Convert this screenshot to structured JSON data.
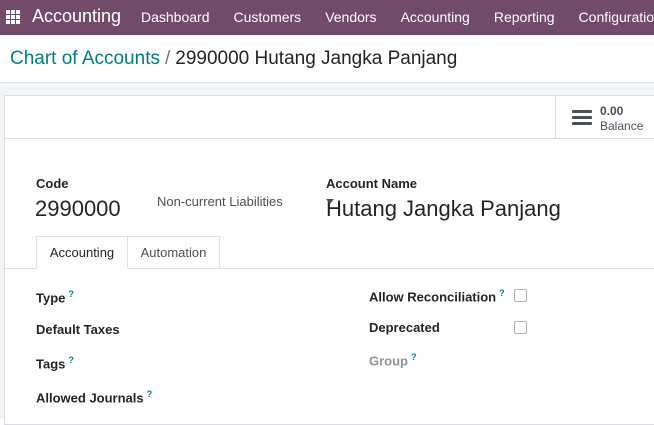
{
  "navbar": {
    "brand": "Accounting",
    "menu": [
      "Dashboard",
      "Customers",
      "Vendors",
      "Accounting",
      "Reporting",
      "Configuration"
    ]
  },
  "breadcrumb": {
    "parent": "Chart of Accounts",
    "separator": "/",
    "current": "2990000 Hutang Jangka Panjang"
  },
  "stat_button": {
    "value": "0.00",
    "label": "Balance"
  },
  "header_fields": {
    "code_label": "Code",
    "code_value": "2990000",
    "name_label": "Account Name",
    "name_value": "Hutang Jangka Panjang"
  },
  "tabs": [
    "Accounting",
    "Automation"
  ],
  "form": {
    "type_label": "Type",
    "type_value": "Non-current Liabilities",
    "default_taxes_label": "Default Taxes",
    "tags_label": "Tags",
    "allowed_journals_label": "Allowed Journals",
    "allow_reconciliation_label": "Allow Reconciliation",
    "allow_reconciliation_checked": false,
    "deprecated_label": "Deprecated",
    "deprecated_checked": false,
    "group_label": "Group",
    "help_mark": "?"
  },
  "colors": {
    "navbar": "#714B67",
    "link": "#017e84"
  }
}
